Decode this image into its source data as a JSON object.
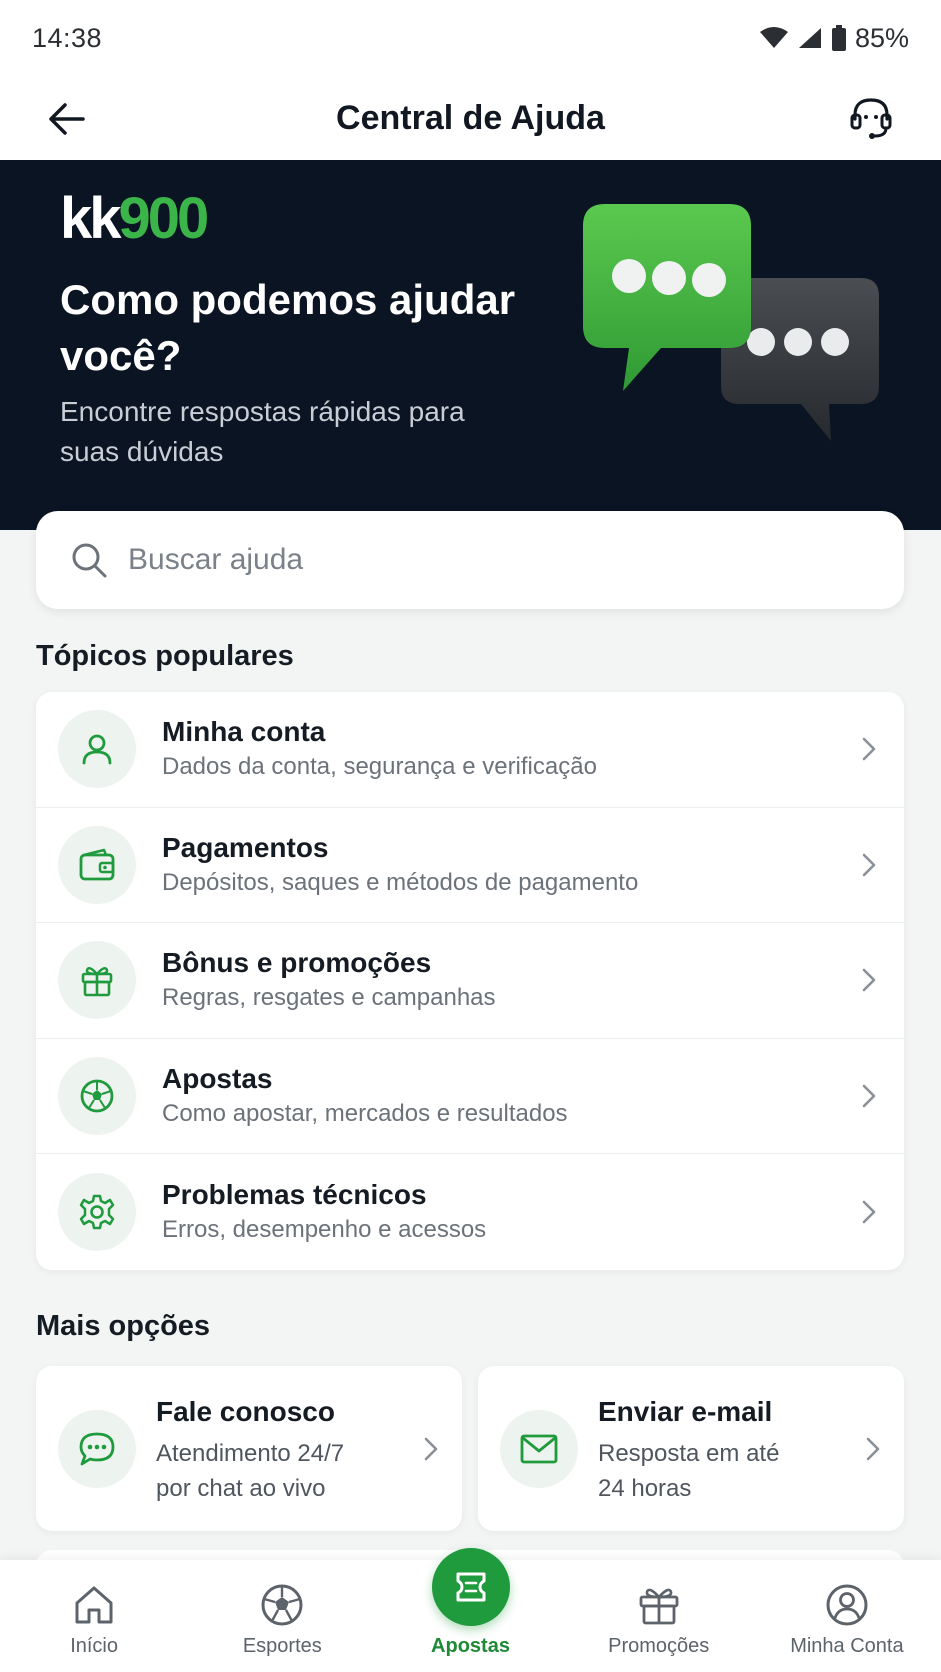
{
  "status_bar": {
    "time": "14:38",
    "battery": "85%"
  },
  "header": {
    "title": "Central de Ajuda",
    "back_icon": "arrow-left-icon",
    "support_icon": "headset-icon"
  },
  "hero": {
    "logo_kk": "kk",
    "logo_num": "900",
    "title": "Como podemos ajudar você?",
    "subtitle": "Encontre respostas rápidas para suas dúvidas"
  },
  "search": {
    "placeholder": "Buscar ajuda",
    "value": ""
  },
  "popular": {
    "title": "Tópicos populares",
    "items": [
      {
        "title": "Minha conta",
        "desc": "Dados da conta, segurança e verificação",
        "icon": "user-icon"
      },
      {
        "title": "Pagamentos",
        "desc": "Depósitos, saques e métodos de pagamento",
        "icon": "wallet-icon"
      },
      {
        "title": "Bônus e promoções",
        "desc": "Regras, resgates e campanhas",
        "icon": "gift-icon"
      },
      {
        "title": "Apostas",
        "desc": "Como apostar, mercados e resultados",
        "icon": "soccer-ball-icon"
      },
      {
        "title": "Problemas técnicos",
        "desc": "Erros, desempenho e acessos",
        "icon": "gear-icon"
      }
    ]
  },
  "more": {
    "title": "Mais opções",
    "items": [
      {
        "title": "Fale conosco",
        "desc_line1": "Atendimento 24/7",
        "desc_line2": "por chat ao vivo",
        "icon": "chat-icon"
      },
      {
        "title": "Enviar e-mail",
        "desc_line1": "Resposta em até",
        "desc_line2": "24 horas",
        "icon": "mail-icon"
      }
    ]
  },
  "bottom_nav": {
    "items": [
      {
        "label": "Início",
        "icon": "home-icon",
        "active": false
      },
      {
        "label": "Esportes",
        "icon": "soccer-ball-icon",
        "active": false
      },
      {
        "label": "Apostas",
        "icon": "ticket-icon",
        "active": true
      },
      {
        "label": "Promoções",
        "icon": "gift-icon",
        "active": false
      },
      {
        "label": "Minha Conta",
        "icon": "user-circle-icon",
        "active": false
      }
    ]
  },
  "colors": {
    "brand_green": "#3bb54a",
    "accent_green": "#1f9a3c",
    "hero_bg": "#0b1422"
  }
}
